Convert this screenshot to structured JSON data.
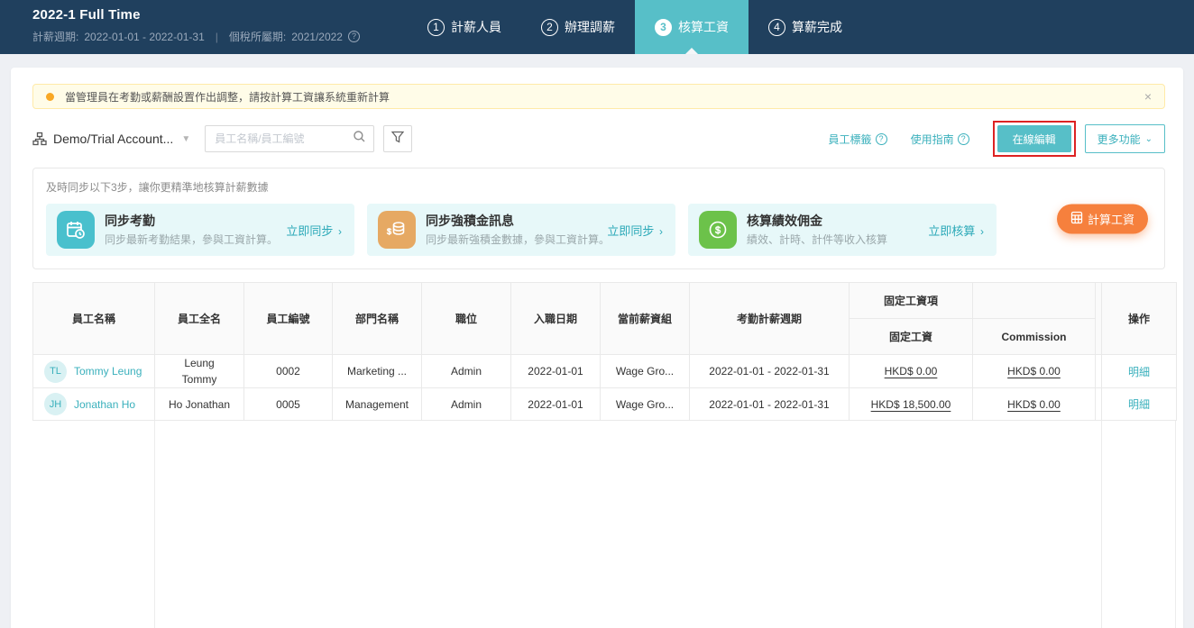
{
  "colors": {
    "navbar_bg": "#20405e",
    "active_step_bg": "#57bfc8",
    "accent_teal": "#3ab0bc",
    "orange_button": "#f6803d",
    "alert_bg": "#fffce8",
    "alert_border": "#ffeaa8",
    "alert_dot": "#f9a825",
    "annotation_red": "#dd2222"
  },
  "icons": [
    "question-circle-icon",
    "org-tree-icon",
    "search-icon",
    "filter-icon",
    "warning-dot-icon",
    "close-icon",
    "calendar-clock-icon",
    "coins-icon",
    "dollar-circle-icon",
    "calculator-icon",
    "chevron-down-icon",
    "chevron-right-icon"
  ],
  "navbar": {
    "title": "2022-1 Full Time",
    "period_label": "計薪週期:",
    "period_value": "2022-01-01 - 2022-01-31",
    "divider": "|",
    "tax_label": "個稅所屬期:",
    "tax_value": "2021/2022",
    "steps": [
      {
        "num": "1",
        "label": "計薪人員"
      },
      {
        "num": "2",
        "label": "辦理調薪"
      },
      {
        "num": "3",
        "label": "核算工資"
      },
      {
        "num": "4",
        "label": "算薪完成"
      }
    ]
  },
  "alert": {
    "text": "當管理員在考勤或薪酬設置作出調整，請按計算工資讓系統重新計算",
    "close": "×"
  },
  "toolbar": {
    "org_selector": "Demo/Trial Account...",
    "search_placeholder": "員工名稱/員工編號",
    "employee_tags": "員工標籤",
    "user_guide": "使用指南",
    "online_edit": "在線編輯",
    "more_functions": "更多功能"
  },
  "sync": {
    "header": "及時同步以下3步，讓你更精準地核算計薪數據",
    "cards": [
      {
        "title": "同步考勤",
        "desc": "同步最新考勤結果，參與工資計算。",
        "action": "立即同步"
      },
      {
        "title": "同步強積金訊息",
        "desc": "同步最新強積金數據，參與工資計算。",
        "action": "立即同步"
      },
      {
        "title": "核算績效佣金",
        "desc": "績效、計時、計件等收入核算",
        "action": "立即核算"
      }
    ],
    "calculate_button": "計算工資"
  },
  "table": {
    "headers": {
      "employee_name": "員工名稱",
      "full_name": "員工全名",
      "employee_no": "員工編號",
      "department": "部門名稱",
      "position": "職位",
      "hire_date": "入職日期",
      "wage_group": "當前薪資組",
      "attendance_period": "考勤計薪週期",
      "fixed_wage_group": "固定工資項",
      "fixed_wage": "固定工資",
      "commission": "Commission",
      "action": "操作"
    },
    "rows": [
      {
        "initials": "TL",
        "name": "Tommy Leung",
        "full_name": "Leung Tommy",
        "emp_no": "0002",
        "department": "Marketing ...",
        "position": "Admin",
        "hire_date": "2022-01-01",
        "wage_group": "Wage Gro...",
        "attendance_period": "2022-01-01 - 2022-01-31",
        "fixed_wage": "HKD$ 0.00",
        "commission": "HKD$ 0.00",
        "action": "明細"
      },
      {
        "initials": "JH",
        "name": "Jonathan Ho",
        "full_name": "Ho Jonathan",
        "emp_no": "0005",
        "department": "Management",
        "position": "Admin",
        "hire_date": "2022-01-01",
        "wage_group": "Wage Gro...",
        "attendance_period": "2022-01-01 - 2022-01-31",
        "fixed_wage": "HKD$ 18,500.00",
        "commission": "HKD$ 0.00",
        "action": "明細"
      }
    ]
  }
}
